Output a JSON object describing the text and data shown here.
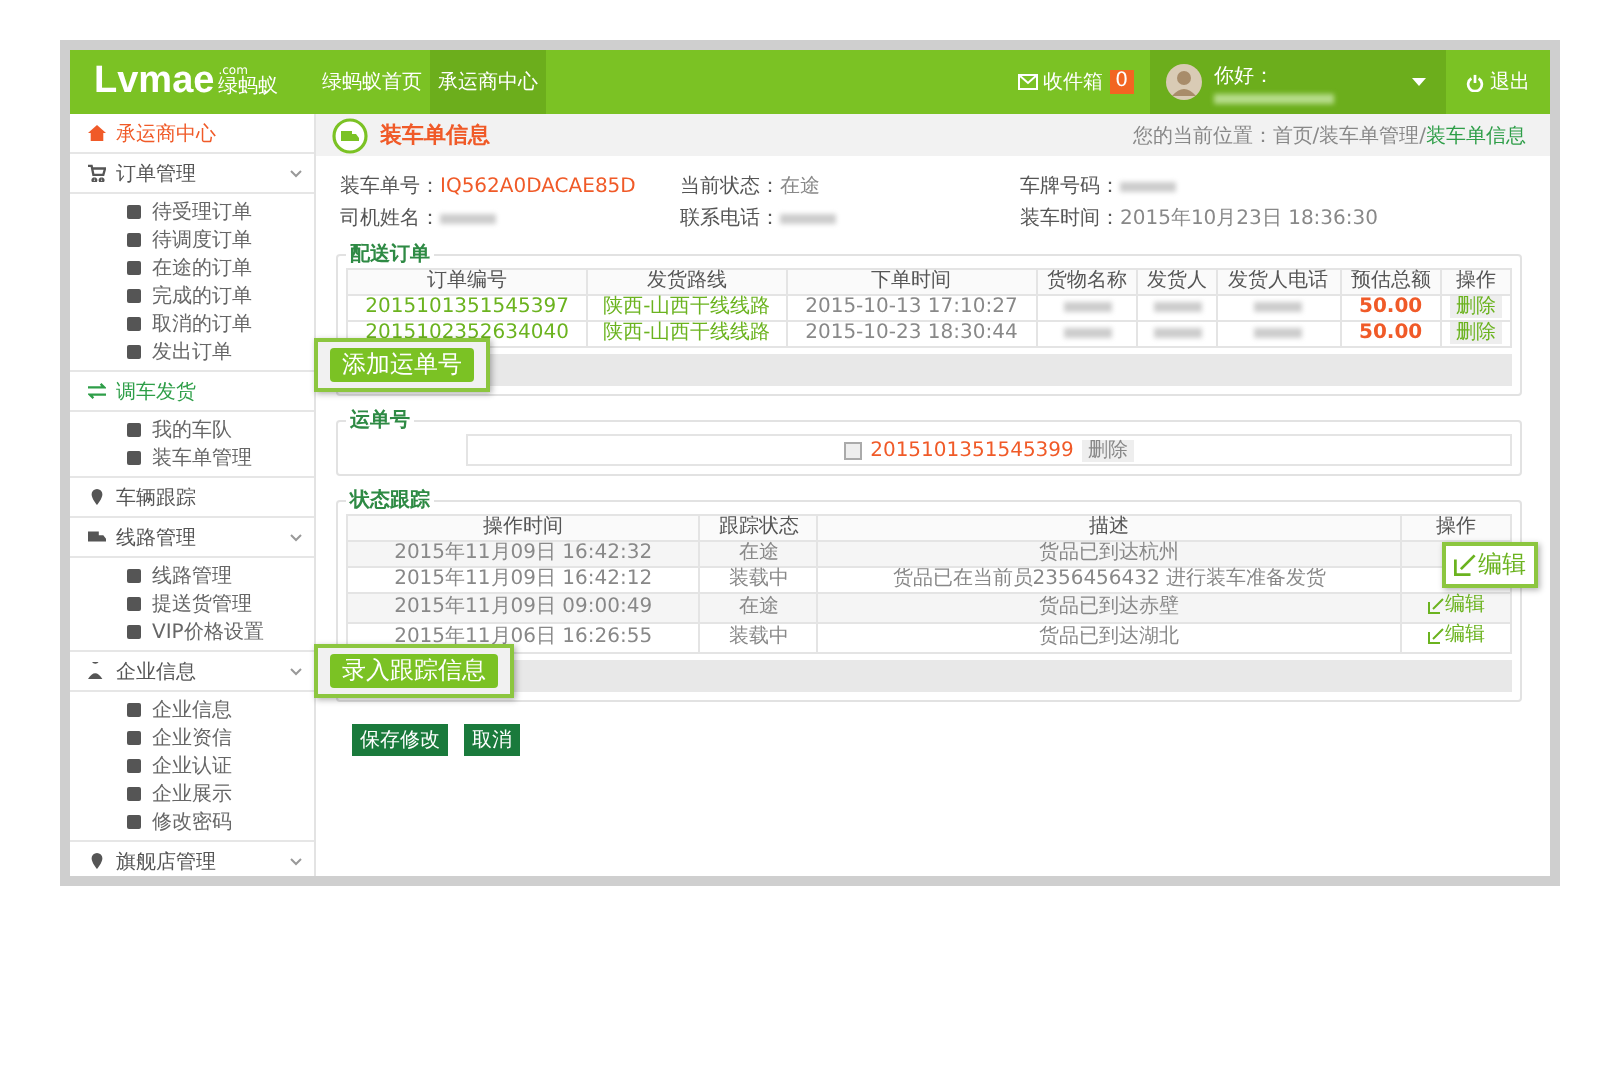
{
  "header": {
    "logo": "Lvmae",
    "logo_domain": ".com",
    "logo_cn": "绿蚂蚁",
    "nav": [
      {
        "label": "绿蚂蚁首页",
        "selected": false
      },
      {
        "label": "承运商中心",
        "selected": true
      }
    ],
    "inbox": {
      "label": "收件箱",
      "count": "0"
    },
    "greeting": "你好：",
    "logout": "退出"
  },
  "sidebar": [
    {
      "label": "承运商中心",
      "color": "#f05a28",
      "toggle": false
    },
    {
      "label": "订单管理",
      "color": "#555555",
      "toggle": true,
      "children": [
        "待受理订单",
        "待调度订单",
        "在途的订单",
        "完成的订单",
        "取消的订单",
        "发出订单"
      ]
    },
    {
      "label": "调车发货",
      "color": "#2e9e48",
      "toggle": false,
      "children": [
        "我的车队",
        "装车单管理"
      ]
    },
    {
      "label": "车辆跟踪",
      "color": "#555555",
      "toggle": false
    },
    {
      "label": "线路管理",
      "color": "#555555",
      "toggle": true,
      "children": [
        "线路管理",
        "提送货管理",
        "VIP价格设置"
      ]
    },
    {
      "label": "企业信息",
      "color": "#555555",
      "toggle": true,
      "children": [
        "企业信息",
        "企业资信",
        "企业认证",
        "企业展示",
        "修改密码"
      ]
    },
    {
      "label": "旗舰店管理",
      "color": "#555555",
      "toggle": true
    }
  ],
  "page_title": "装车单信息",
  "breadcrumb": {
    "path": "您的当前位置：首页/装车单管理/",
    "current": "装车单信息"
  },
  "fields": [
    {
      "label": "装车单号：",
      "value": "IQ562A0DACAE85D",
      "highlight": true,
      "redacted": false
    },
    {
      "label": "当前状态：",
      "value": "在途",
      "highlight": false,
      "redacted": false
    },
    {
      "label": "车牌号码：",
      "redacted": true
    },
    {
      "label": "司机姓名：",
      "redacted": true
    },
    {
      "label": "联系电话：",
      "redacted": true
    },
    {
      "label": "装车时间：",
      "value": "2015年10月23日 18:36:30",
      "highlight": false,
      "redacted": false
    }
  ],
  "orders": {
    "title": "配送订单",
    "columns": [
      "订单编号",
      "发货路线",
      "下单时间",
      "货物名称",
      "发货人",
      "发货人电话",
      "预估总额",
      "操作"
    ],
    "rows": [
      {
        "cells": [
          {
            "kind": "link",
            "text": "2015101351545397"
          },
          {
            "kind": "link",
            "text": "陕西-山西干线线路"
          },
          {
            "kind": "plain",
            "text": "2015-10-13 17:10:27"
          },
          {
            "kind": "redacted"
          },
          {
            "kind": "redacted"
          },
          {
            "kind": "redacted"
          },
          {
            "kind": "amount",
            "text": "50.00"
          },
          {
            "kind": "action",
            "text": "删除"
          }
        ]
      },
      {
        "cells": [
          {
            "kind": "link",
            "text": "2015102352634040"
          },
          {
            "kind": "link",
            "text": "陕西-山西干线线路"
          },
          {
            "kind": "plain",
            "text": "2015-10-23 18:30:44"
          },
          {
            "kind": "redacted"
          },
          {
            "kind": "redacted"
          },
          {
            "kind": "redacted"
          },
          {
            "kind": "amount",
            "text": "50.00"
          },
          {
            "kind": "action",
            "text": "删除"
          }
        ]
      }
    ]
  },
  "waybill": {
    "title": "运单号",
    "number": "2015101351545399",
    "checked": false,
    "action": "删除"
  },
  "tracking": {
    "title": "状态跟踪",
    "columns": [
      "操作时间",
      "跟踪状态",
      "描述",
      "操作"
    ],
    "rows": [
      {
        "time": "2015年11月09日 16:42:32",
        "status": "在途",
        "description": "货品已到达杭州"
      },
      {
        "time": "2015年11月09日 16:42:12",
        "status": "装载中",
        "description": "货品已在当前员2356456432 进行装车准备发货"
      },
      {
        "time": "2015年11月09日 09:00:49",
        "status": "在途",
        "description": "货品已到达赤壁",
        "action": "编辑"
      },
      {
        "time": "2015年11月06日 16:26:55",
        "status": "装载中",
        "description": "货品已到达湖北",
        "action": "编辑"
      }
    ]
  },
  "buttons": [
    "保存修改",
    "取消"
  ],
  "callouts": [
    {
      "label": "添加运单号",
      "kind": "button"
    },
    {
      "label": "录入跟踪信息",
      "kind": "button"
    },
    {
      "label": "编辑",
      "kind": "edit"
    }
  ]
}
